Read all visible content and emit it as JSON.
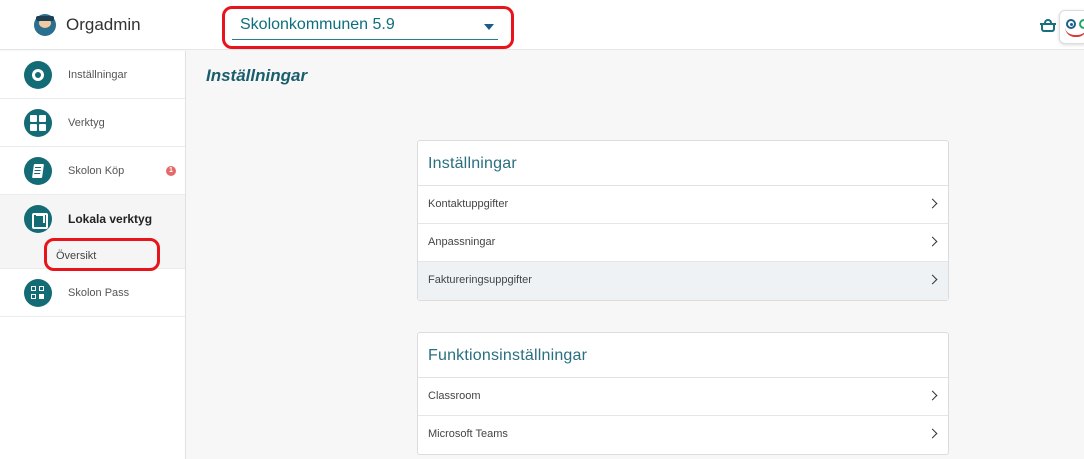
{
  "app": {
    "name": "Orgadmin"
  },
  "org_select": {
    "value": "Skolonkommunen 5.9"
  },
  "sidebar": {
    "items": [
      {
        "label": "Inställningar",
        "icon": "gear-icon"
      },
      {
        "label": "Verktyg",
        "icon": "grid-icon"
      },
      {
        "label": "Skolon Köp",
        "icon": "book-icon",
        "badge": "1"
      },
      {
        "label": "Lokala verktyg",
        "icon": "external-link-icon",
        "active": true
      },
      {
        "label": "Skolon Pass",
        "icon": "qr-code-icon"
      }
    ],
    "subitem": {
      "label": "Översikt"
    }
  },
  "main": {
    "title": "Inställningar",
    "cards": [
      {
        "title": "Inställningar",
        "rows": [
          "Kontaktuppgifter",
          "Anpassningar",
          "Faktureringsuppgifter"
        ]
      },
      {
        "title": "Funktionsinställningar",
        "rows": [
          "Classroom",
          "Microsoft Teams"
        ]
      }
    ]
  },
  "colors": {
    "accent": "#136b76",
    "title": "#1a5d6c",
    "annotation": "#e8141c",
    "badge": "#e46a6a"
  }
}
